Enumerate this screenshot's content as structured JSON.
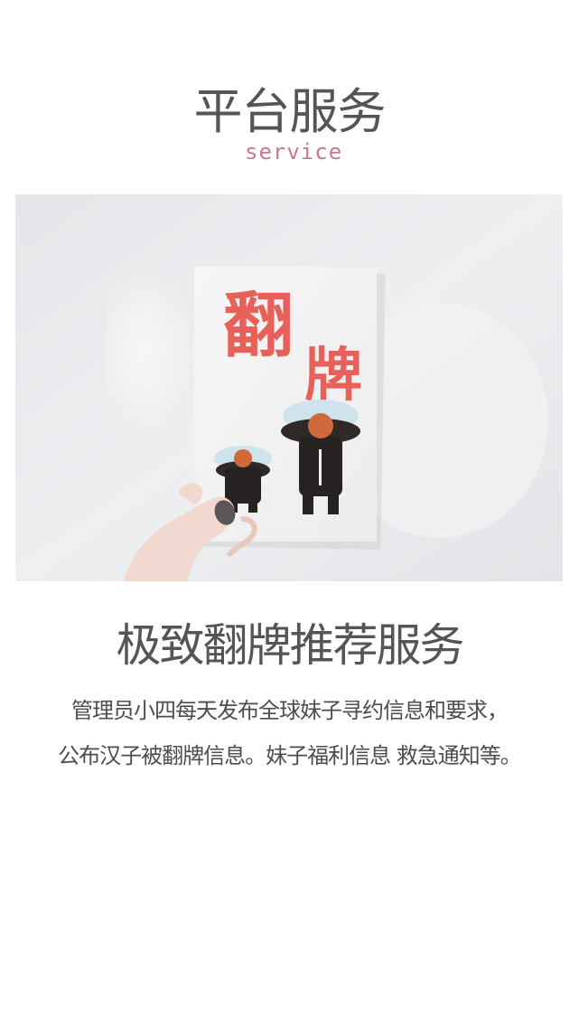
{
  "header": {
    "title": "平台服务",
    "subtitle": "service"
  },
  "hero": {
    "card_char_1": "翻",
    "card_char_2": "牌"
  },
  "section": {
    "title": "极致翻牌推荐服务",
    "description_line_1": "管理员小四每天发布全球妹子寻约信息和要求，",
    "description_line_2": "公布汉子被翻牌信息。妹子福利信息 救急通知等。"
  },
  "colors": {
    "title": "#555555",
    "subtitle_accent": "#c9788f",
    "card_text": "#e8605a"
  }
}
